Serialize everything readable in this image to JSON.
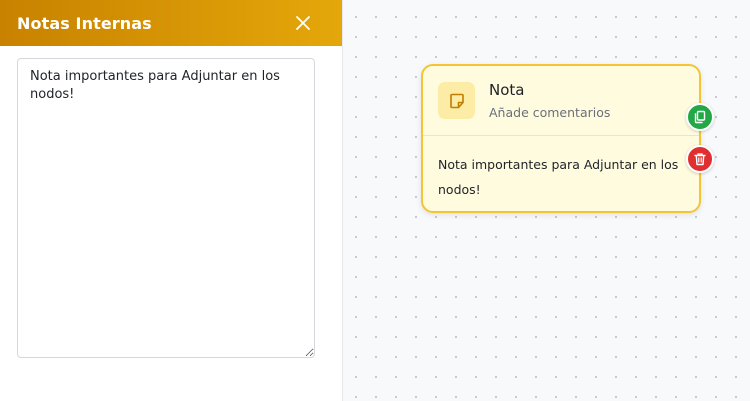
{
  "panel": {
    "title": "Notas Internas",
    "notes_value": "Nota importantes para Adjuntar en los nodos!"
  },
  "node": {
    "title": "Nota",
    "subtitle": "Añade comentarios",
    "body": "Nota importantes para Adjuntar en los nodos!",
    "icon": "sticky-note-icon"
  },
  "actions": {
    "copy_icon": "copy-icon",
    "delete_icon": "trash-icon"
  },
  "colors": {
    "header_start": "#c88200",
    "header_end": "#e4a70a",
    "node_border": "#f3c536",
    "node_bg": "#fffbdf",
    "copy": "#22a845",
    "delete": "#df2f2f"
  }
}
